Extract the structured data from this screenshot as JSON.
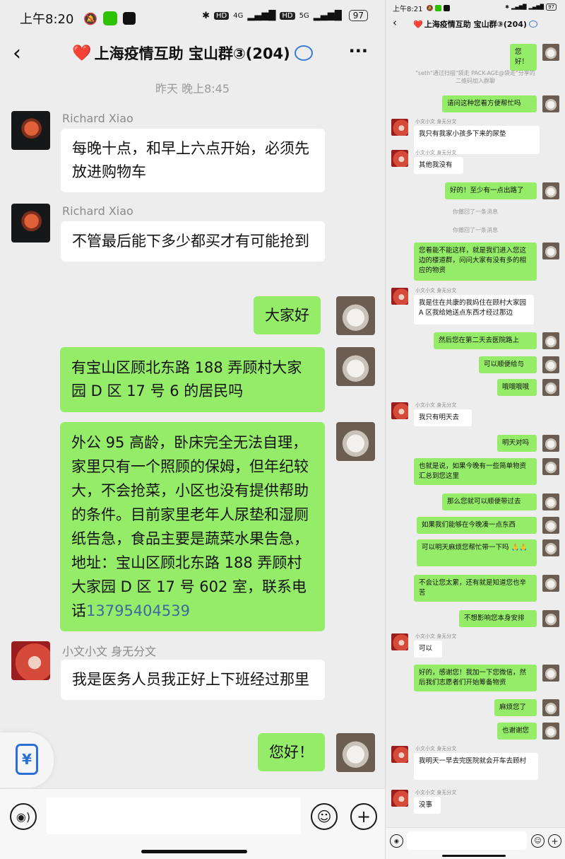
{
  "left": {
    "status": {
      "time": "上午8:20",
      "battery": "97",
      "net1": "4G",
      "net2": "5G"
    },
    "header": {
      "heart": "❤️",
      "title": "上海疫情互助 宝山群③(204)"
    },
    "time_sep": "昨天 晚上8:45",
    "messages": [
      {
        "name": "Richard Xiao",
        "text": "每晚十点，和早上六点开始，必须先放进购物车"
      },
      {
        "name": "Richard Xiao",
        "text": "不管最后能下多少都买才有可能抢到"
      },
      {
        "text": "大家好"
      },
      {
        "text": "有宝山区顾北东路 188 弄顾村大家园 D 区 17 号 6 的居民吗"
      },
      {
        "text": "外公 95 高龄，卧床完全无法自理，家里只有一个照顾的保姆，但年纪较大，不会抢菜，小区也没有提供帮助的条件。目前家里老年人尿垫和湿厕纸告急，食品主要是蔬菜水果告急，地址：宝山区顾北东路 188 弄顾村大家园 D 区 17 号 602 室，联系电话",
        "phone": "13795404539"
      },
      {
        "name": "小文小文 身无分文",
        "text": "我是医务人员我正好上下班经过那里"
      },
      {
        "text": "您好！"
      }
    ],
    "float_icon": "¥"
  },
  "right": {
    "status": {
      "time": "上午8:21",
      "battery": "97"
    },
    "header": {
      "heart": "❤️",
      "title": "上海疫情互助 宝山群③(204)"
    },
    "messages": [
      {
        "text": "您好！"
      },
      {
        "sys": "\"seth\"通过扫描\"袋走 PACK-AGE@袋走\"分享的二维码加入群聊"
      },
      {
        "text": "请问这种您看方便帮忙吗"
      },
      {
        "name": "小文小文 身无分文",
        "text": "我只有我家小孩多下来的尿垫"
      },
      {
        "name": "小文小文 身无分文",
        "text": "其他我没有"
      },
      {
        "text": "好的！至少有一点出路了"
      },
      {
        "sys": "你撤回了一条消息"
      },
      {
        "sys": "你撤回了一条消息"
      },
      {
        "text": "您看能不能这样，就是我们进入您这边的楼道群，问问大家有没有多的相应的物资"
      },
      {
        "name": "小文小文 身无分文",
        "text": "我是住在共康的我妈住在顾村大家园 A 区我给她送点东西才经过那边"
      },
      {
        "text": "然后您在第二天去医院路上"
      },
      {
        "text": "可以顺便给与"
      },
      {
        "text": "哦哦哦哦"
      },
      {
        "name": "小文小文 身无分文",
        "text": "我只有明天去"
      },
      {
        "text": "明天对吗"
      },
      {
        "text": "也就是说，如果今晚有一些简单物资汇总到您这里"
      },
      {
        "text": "那么您就可以顺便带过去"
      },
      {
        "text": "如果我们能够在今晚凑一点东西"
      },
      {
        "text": "可以明天麻烦您帮忙带一下吗 🙏🙏"
      },
      {
        "text": "不会让您太累，还有就是知道您也辛苦"
      },
      {
        "text": "不想影响您本身安排"
      },
      {
        "name": "小文小文 身无分文",
        "text": "可以"
      },
      {
        "text": "好的，感谢您！我加一下您微信，然后我们志愿者们开始筹备物资"
      },
      {
        "text": "麻烦您了"
      },
      {
        "text": "也谢谢您"
      },
      {
        "name": "小文小文 身无分文",
        "text": "我明天一早去完医院就会开车去顾村"
      },
      {
        "name": "小文小文 身无分文",
        "text": "没事"
      }
    ]
  }
}
